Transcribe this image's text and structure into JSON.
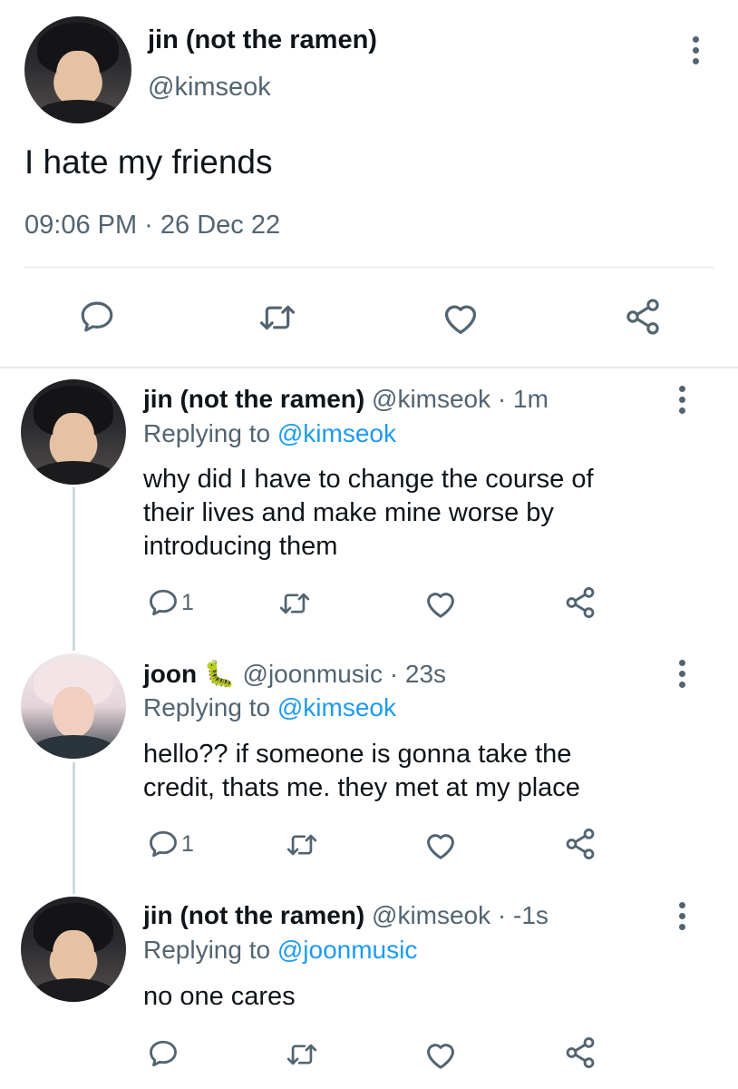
{
  "main_tweet": {
    "name": "jin (not the ramen)",
    "handle": "@kimseok",
    "text": "I hate my friends",
    "timestamp": "09:06 PM · 26 Dec 22"
  },
  "replies": [
    {
      "name": "jin (not the ramen)",
      "handle": "@kimseok",
      "time": "· 1m",
      "replying_label": "Replying to",
      "replying_to": "@kimseok",
      "text_lines": [
        "why did I have to change the course of",
        "their lives and make mine worse by",
        "introducing them"
      ],
      "reply_count": "1"
    },
    {
      "name": "joon",
      "emoji": "🐛",
      "handle": "@joonmusic",
      "time": "· 23s",
      "replying_label": "Replying to",
      "replying_to": "@kimseok",
      "text_lines": [
        "hello?? if someone is gonna take the",
        "credit, thats me. they met at my place"
      ],
      "reply_count": "1"
    },
    {
      "name": "jin (not the ramen)",
      "handle": "@kimseok",
      "time": "· -1s",
      "replying_label": "Replying to",
      "replying_to": "@joonmusic",
      "text_lines": [
        "no one cares"
      ],
      "reply_count": ""
    }
  ],
  "icons": {
    "reply": "reply-icon",
    "retweet": "retweet-icon",
    "like": "heart-icon",
    "share": "share-icon",
    "more": "more-vertical-icon"
  },
  "colors": {
    "text": "#0f1419",
    "secondary": "#536471",
    "link": "#1d9bf0",
    "divider": "#e1e4e7"
  }
}
